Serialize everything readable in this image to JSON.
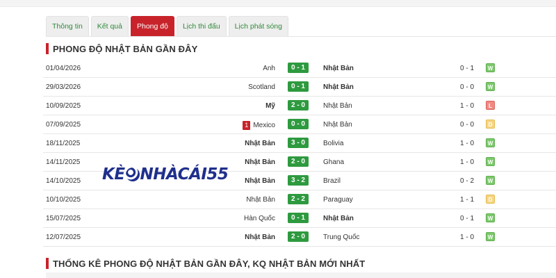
{
  "tabs": [
    {
      "label": "Thông tin",
      "active": false
    },
    {
      "label": "Kết quả",
      "active": false
    },
    {
      "label": "Phong độ",
      "active": true
    },
    {
      "label": "Lịch thi đấu",
      "active": false
    },
    {
      "label": "Lịch phát sóng",
      "active": false
    }
  ],
  "section1": {
    "title": "PHONG ĐỘ NHẬT BẢN GẦN ĐÂY"
  },
  "section2": {
    "title": "THỐNG KÊ PHONG ĐỘ NHẬT BẢN GẦN ĐÂY, KQ NHẬT BẢN MỚI NHẤT"
  },
  "watermark": {
    "part1": "KÈ",
    "part2": "NHÀCÁI55"
  },
  "colors": {
    "accent": "#c8232b",
    "score": "#2e9a3f",
    "win": "#7cc96b",
    "draw": "#f6d585",
    "loss": "#f08a84"
  },
  "matches": [
    {
      "date": "01/04/2026",
      "home": "Anh",
      "home_bold": false,
      "red_cards": "",
      "score": "0 - 1",
      "away": "Nhật Bản",
      "away_bold": true,
      "ht": "0 - 1",
      "result": "W"
    },
    {
      "date": "29/03/2026",
      "home": "Scotland",
      "home_bold": false,
      "red_cards": "",
      "score": "0 - 1",
      "away": "Nhật Bản",
      "away_bold": true,
      "ht": "0 - 0",
      "result": "W"
    },
    {
      "date": "10/09/2025",
      "home": "Mỹ",
      "home_bold": true,
      "red_cards": "",
      "score": "2 - 0",
      "away": "Nhật Bản",
      "away_bold": false,
      "ht": "1 - 0",
      "result": "L"
    },
    {
      "date": "07/09/2025",
      "home": "Mexico",
      "home_bold": false,
      "red_cards": "1",
      "score": "0 - 0",
      "away": "Nhật Bản",
      "away_bold": false,
      "ht": "0 - 0",
      "result": "D"
    },
    {
      "date": "18/11/2025",
      "home": "Nhật Bản",
      "home_bold": true,
      "red_cards": "",
      "score": "3 - 0",
      "away": "Bolivia",
      "away_bold": false,
      "ht": "1 - 0",
      "result": "W"
    },
    {
      "date": "14/11/2025",
      "home": "Nhật Bản",
      "home_bold": true,
      "red_cards": "",
      "score": "2 - 0",
      "away": "Ghana",
      "away_bold": false,
      "ht": "1 - 0",
      "result": "W"
    },
    {
      "date": "14/10/2025",
      "home": "Nhật Bản",
      "home_bold": true,
      "red_cards": "",
      "score": "3 - 2",
      "away": "Brazil",
      "away_bold": false,
      "ht": "0 - 2",
      "result": "W"
    },
    {
      "date": "10/10/2025",
      "home": "Nhật Bản",
      "home_bold": false,
      "red_cards": "",
      "score": "2 - 2",
      "away": "Paraguay",
      "away_bold": false,
      "ht": "1 - 1",
      "result": "D"
    },
    {
      "date": "15/07/2025",
      "home": "Hàn Quốc",
      "home_bold": false,
      "red_cards": "",
      "score": "0 - 1",
      "away": "Nhật Bản",
      "away_bold": true,
      "ht": "0 - 1",
      "result": "W"
    },
    {
      "date": "12/07/2025",
      "home": "Nhật Bản",
      "home_bold": true,
      "red_cards": "",
      "score": "2 - 0",
      "away": "Trung Quốc",
      "away_bold": false,
      "ht": "1 - 0",
      "result": "W"
    }
  ]
}
